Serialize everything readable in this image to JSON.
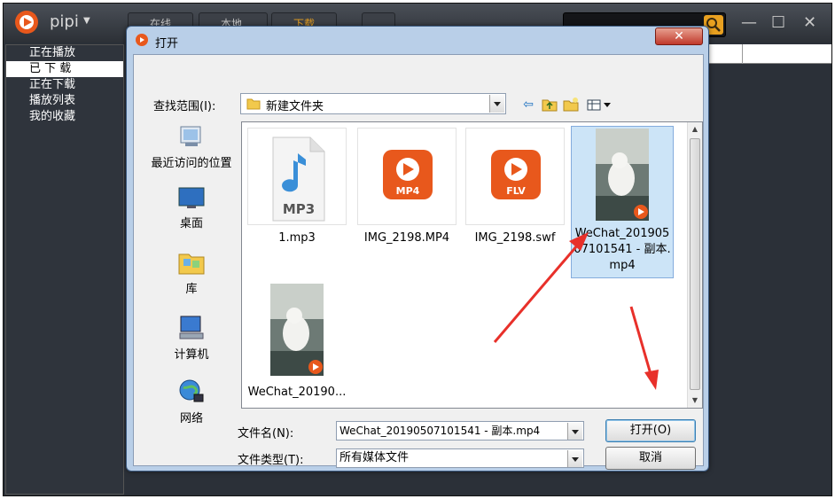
{
  "app": {
    "name": "pipi",
    "top_buttons": [
      "在线",
      "本地",
      "下载"
    ],
    "sidebar": [
      {
        "label": "正在播放",
        "active": false
      },
      {
        "label": "已 下 载",
        "active": true
      },
      {
        "label": "正在下载",
        "active": false
      },
      {
        "label": "播放列表",
        "active": false
      },
      {
        "label": "我的收藏",
        "active": false
      }
    ]
  },
  "dialog": {
    "title": "打开",
    "close_glyph": "✕",
    "lookin_label": "查找范围(I):",
    "lookin_value": "新建文件夹",
    "places": [
      {
        "label": "最近访问的位置",
        "icon": "recent-places-icon"
      },
      {
        "label": "桌面",
        "icon": "desktop-icon"
      },
      {
        "label": "库",
        "icon": "libraries-icon"
      },
      {
        "label": "计算机",
        "icon": "computer-icon"
      },
      {
        "label": "网络",
        "icon": "network-icon"
      }
    ],
    "files": [
      {
        "name": "1.mp3",
        "kind": "mp3",
        "badge": "MP3",
        "selected": false
      },
      {
        "name": "IMG_2198.MP4",
        "kind": "mp4",
        "badge": "MP4",
        "selected": false
      },
      {
        "name": "IMG_2198.swf",
        "kind": "flv",
        "badge": "FLV",
        "selected": false
      },
      {
        "name": "WeChat_20190507101541 - 副本.mp4",
        "kind": "video-thumb",
        "selected": true
      },
      {
        "name": "WeChat_20190...",
        "kind": "video-thumb",
        "selected": false
      }
    ],
    "filename_label": "文件名(N):",
    "filename_value": "WeChat_20190507101541 - 副本.mp4",
    "filetype_label": "文件类型(T):",
    "filetype_value": "所有媒体文件",
    "open_button": "打开(O)",
    "cancel_button": "取消"
  },
  "colors": {
    "accent_orange": "#e8581c",
    "annotation_red": "#e8302a",
    "selection_blue": "#cce4f7"
  }
}
